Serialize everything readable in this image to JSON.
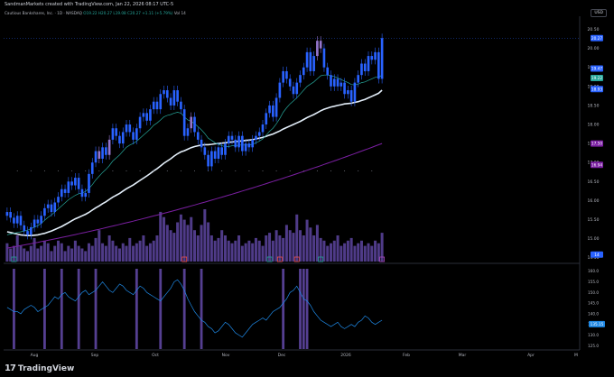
{
  "header": {
    "caption": "SandmanMarkets created with TradingView.com, Jan 22, 2026 08:17 UTC-5",
    "symbol_line": "Cautious Bankshares, Inc. · 1D · NASDAQ",
    "ohlc": "O19.22 H20.27 L19.08 C20.27 +1.11 (+5.79%)",
    "vol": "Vol 14"
  },
  "currency_label": "USD",
  "brand": {
    "logo_text": "17",
    "name": "TradingView"
  },
  "colors": {
    "up": "#26a69a",
    "bull_candle": "#2962ff",
    "highlight_candle": "#9575cd",
    "ma_short": "#26a69a",
    "ma_mid": "#e3eef9",
    "ma_long": "#7b1fa2",
    "oscillator": "#1e88e5",
    "bar_purple": "#6a4fb5"
  },
  "chart_data": {
    "type": "candlestick",
    "x_ticks": [
      "Aug",
      "Sep",
      "Oct",
      "Nov",
      "Dec",
      "2026",
      "Feb",
      "Mar",
      "Apr",
      "M"
    ],
    "price_ticks": [
      20.5,
      20.0,
      19.5,
      19.0,
      18.5,
      18.0,
      17.5,
      17.0,
      16.5,
      16.0,
      15.5,
      15.0,
      14.5
    ],
    "ylim": [
      14.35,
      20.75
    ],
    "badges": [
      {
        "label": "20.27",
        "value": 20.27,
        "color": "#2962ff"
      },
      {
        "label": "19.47",
        "value": 19.47,
        "color": "#2962ff"
      },
      {
        "label": "19.22",
        "value": 19.22,
        "color": "#26a69a"
      },
      {
        "label": "18.93",
        "value": 18.93,
        "color": "#2962ff"
      },
      {
        "label": "17.50",
        "value": 17.5,
        "color": "#7b1fa2"
      },
      {
        "label": "16.94",
        "value": 16.94,
        "color": "#7b1fa2"
      },
      {
        "label": "14",
        "value": 14.58,
        "color": "#2962ff"
      }
    ],
    "closes": [
      15.7,
      15.55,
      15.4,
      15.6,
      15.35,
      15.2,
      15.1,
      15.3,
      15.5,
      15.4,
      15.6,
      15.8,
      15.9,
      15.7,
      15.95,
      16.1,
      16.3,
      16.2,
      16.5,
      16.4,
      16.6,
      16.3,
      16.1,
      16.2,
      16.7,
      17.0,
      17.3,
      17.1,
      17.4,
      17.2,
      17.6,
      17.9,
      17.7,
      17.5,
      17.8,
      18.0,
      17.8,
      17.6,
      17.9,
      18.2,
      18.3,
      18.1,
      18.4,
      18.6,
      18.4,
      18.8,
      18.9,
      18.7,
      18.5,
      18.9,
      18.6,
      18.4,
      17.7,
      17.9,
      18.2,
      17.8,
      17.6,
      17.4,
      17.2,
      16.9,
      17.3,
      17.1,
      17.4,
      17.2,
      17.5,
      17.7,
      17.6,
      17.4,
      17.7,
      17.3,
      17.5,
      17.4,
      17.6,
      17.7,
      17.8,
      18.0,
      18.3,
      18.5,
      18.2,
      18.7,
      19.1,
      19.4,
      19.2,
      19.0,
      18.8,
      19.1,
      19.3,
      19.5,
      19.9,
      19.4,
      19.8,
      20.2,
      20.0,
      19.5,
      19.3,
      19.0,
      19.2,
      19.0,
      19.1,
      18.8,
      18.9,
      18.6,
      19.1,
      19.3,
      19.6,
      19.4,
      19.8,
      19.7,
      19.9,
      19.2,
      20.27
    ],
    "highlight_idx": [
      27,
      30,
      54,
      91,
      92
    ],
    "ma_short": [
      15.1,
      15.12,
      15.14,
      15.16,
      15.18,
      15.2,
      15.22,
      15.26,
      15.3,
      15.34,
      15.4,
      15.48,
      15.56,
      15.62,
      15.7,
      15.78,
      15.86,
      15.94,
      16.02,
      16.08,
      16.14,
      16.18,
      16.2,
      16.24,
      16.32,
      16.42,
      16.54,
      16.64,
      16.74,
      16.82,
      16.92,
      17.04,
      17.12,
      17.2,
      17.3,
      17.4,
      17.46,
      17.5,
      17.56,
      17.64,
      17.72,
      17.8,
      17.88,
      17.98,
      18.04,
      18.12,
      18.2,
      18.24,
      18.26,
      18.3,
      18.32,
      18.3,
      18.2,
      18.12,
      18.08,
      18.02,
      17.94,
      17.86,
      17.76,
      17.64,
      17.58,
      17.52,
      17.48,
      17.44,
      17.42,
      17.42,
      17.44,
      17.44,
      17.46,
      17.46,
      17.46,
      17.46,
      17.48,
      17.52,
      17.56,
      17.62,
      17.72,
      17.82,
      17.9,
      18.02,
      18.16,
      18.32,
      18.44,
      18.54,
      18.62,
      18.7,
      18.8,
      18.9,
      19.0,
      19.06,
      19.12,
      19.2,
      19.28,
      19.3,
      19.3,
      19.28,
      19.26,
      19.22,
      19.18,
      19.14,
      19.1,
      19.05,
      19.04,
      19.06,
      19.1,
      19.12,
      19.16,
      19.2,
      19.24,
      19.24,
      19.3
    ],
    "ma_mid": [
      15.18,
      15.16,
      15.14,
      15.12,
      15.1,
      15.09,
      15.08,
      15.08,
      15.09,
      15.1,
      15.12,
      15.14,
      15.17,
      15.2,
      15.24,
      15.28,
      15.32,
      15.37,
      15.42,
      15.47,
      15.52,
      15.56,
      15.6,
      15.64,
      15.69,
      15.75,
      15.81,
      15.86,
      15.92,
      15.97,
      16.03,
      16.09,
      16.14,
      16.19,
      16.25,
      16.31,
      16.36,
      16.41,
      16.47,
      16.53,
      16.59,
      16.65,
      16.71,
      16.78,
      16.84,
      16.91,
      16.98,
      17.04,
      17.1,
      17.17,
      17.23,
      17.28,
      17.31,
      17.35,
      17.39,
      17.42,
      17.44,
      17.46,
      17.47,
      17.47,
      17.48,
      17.49,
      17.5,
      17.51,
      17.52,
      17.53,
      17.54,
      17.55,
      17.56,
      17.57,
      17.58,
      17.59,
      17.6,
      17.62,
      17.64,
      17.66,
      17.69,
      17.72,
      17.75,
      17.79,
      17.83,
      17.88,
      17.92,
      17.96,
      18.0,
      18.04,
      18.08,
      18.13,
      18.18,
      18.22,
      18.26,
      18.31,
      18.36,
      18.4,
      18.43,
      18.46,
      18.48,
      18.5,
      18.52,
      18.54,
      18.55,
      18.56,
      18.58,
      18.6,
      18.63,
      18.66,
      18.7,
      18.74,
      18.78,
      18.82,
      18.9
    ],
    "ma_long_start": [
      0,
      14.75
    ],
    "ma_long_end": [
      110,
      17.5
    ],
    "volume": [
      0.35,
      0.25,
      0.3,
      0.5,
      0.3,
      0.25,
      0.2,
      0.3,
      0.45,
      0.25,
      0.3,
      0.4,
      0.35,
      0.2,
      0.3,
      0.4,
      0.35,
      0.2,
      0.3,
      0.25,
      0.4,
      0.3,
      0.25,
      0.2,
      0.35,
      0.3,
      0.45,
      0.6,
      0.35,
      0.3,
      0.5,
      0.4,
      0.3,
      0.25,
      0.35,
      0.3,
      0.45,
      0.3,
      0.35,
      0.4,
      0.5,
      0.3,
      0.35,
      0.4,
      0.5,
      0.95,
      0.85,
      0.7,
      0.6,
      0.55,
      0.75,
      0.9,
      0.8,
      0.7,
      0.85,
      0.6,
      0.5,
      0.7,
      1.0,
      0.75,
      0.5,
      0.4,
      0.45,
      0.6,
      0.5,
      0.4,
      0.35,
      0.4,
      0.5,
      0.3,
      0.35,
      0.4,
      0.35,
      0.45,
      0.4,
      0.3,
      0.5,
      0.55,
      0.4,
      0.6,
      0.5,
      0.45,
      0.7,
      0.6,
      0.55,
      0.9,
      0.6,
      0.5,
      0.8,
      0.65,
      0.5,
      0.7,
      0.45,
      0.4,
      0.3,
      0.35,
      0.4,
      0.5,
      0.3,
      0.35,
      0.4,
      0.45,
      0.3,
      0.35,
      0.4,
      0.3,
      0.35,
      0.3,
      0.4,
      0.35,
      0.55
    ],
    "volume_markers": [
      {
        "i": 2,
        "c": "#26a69a"
      },
      {
        "i": 52,
        "c": "#ef5350"
      },
      {
        "i": 77,
        "c": "#26a69a"
      },
      {
        "i": 80,
        "c": "#ef5350"
      },
      {
        "i": 85,
        "c": "#ef5350"
      },
      {
        "i": 92,
        "c": "#26a69a"
      },
      {
        "i": 110,
        "c": "#ab47bc"
      }
    ],
    "osc_ticks": [
      "160.0",
      "155.0",
      "150.0",
      "145.0",
      "140.0",
      "135.0",
      "130.0",
      "125.0"
    ],
    "osc_ylim": [
      123,
      162
    ],
    "osc_badge": "135.15",
    "osc_values": [
      143,
      142,
      141,
      141,
      140,
      142,
      143,
      144,
      143,
      141,
      142,
      143,
      144,
      146,
      148,
      147,
      149,
      150,
      148,
      147,
      146,
      148,
      150,
      151,
      149,
      150,
      151,
      153,
      155,
      153,
      151,
      150,
      152,
      154,
      153,
      151,
      150,
      149,
      151,
      153,
      152,
      150,
      149,
      148,
      147,
      146,
      148,
      150,
      152,
      155,
      156,
      154,
      151,
      147,
      144,
      141,
      139,
      137,
      136,
      134,
      133,
      131,
      132,
      134,
      136,
      135,
      133,
      131,
      130,
      129,
      131,
      133,
      135,
      136,
      137,
      138,
      137,
      139,
      141,
      142,
      143,
      145,
      147,
      150,
      151,
      153,
      150,
      147,
      146,
      144,
      141,
      139,
      137,
      136,
      135,
      134,
      135,
      136,
      134,
      133,
      134,
      135,
      134,
      136,
      137,
      139,
      138,
      136,
      135,
      136,
      137
    ],
    "osc_bars": [
      2,
      11,
      16,
      21,
      26,
      38,
      45,
      52,
      57,
      81,
      86,
      87,
      88
    ]
  }
}
